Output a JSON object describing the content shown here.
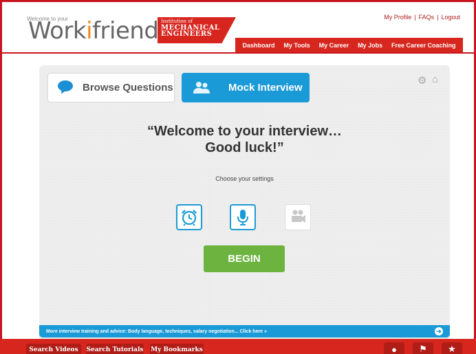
{
  "header": {
    "logo_small": "Welcome to your",
    "logo_main_a": "Work",
    "logo_main_b": "friend",
    "partner_line1": "Institution of",
    "partner_line2": "MECHANICAL",
    "partner_line3": "ENGINEERS",
    "top_links": [
      "My Profile",
      "FAQs",
      "Logout"
    ],
    "nav": [
      "Dashboard",
      "My Tools",
      "My Career",
      "My Jobs",
      "Free Career Coaching"
    ]
  },
  "tabs": {
    "browse_label": "Browse Questions",
    "mock_label": "Mock Interview"
  },
  "main": {
    "headline_line1": "“Welcome to your interview…",
    "headline_line2": "Good luck!”",
    "settings_label": "Choose your settings",
    "begin_label": "BEGIN",
    "info_text": "More interview training and advice: Body language, techniques, salary negotiation... Click here »"
  },
  "toolbar": {
    "buttons": [
      "Search Videos",
      "Search Tutorials",
      "My Bookmarks"
    ]
  },
  "colors": {
    "brand_red": "#d7261e",
    "accent_blue": "#1a9ad6",
    "begin_green": "#6cb33f"
  },
  "icons": [
    "speech-bubble-icon",
    "users-icon",
    "gear-icon",
    "home-icon",
    "alarm-clock-icon",
    "microphone-icon",
    "video-camera-icon",
    "arrow-right-icon",
    "chat-icon",
    "flag-icon",
    "star-icon"
  ]
}
